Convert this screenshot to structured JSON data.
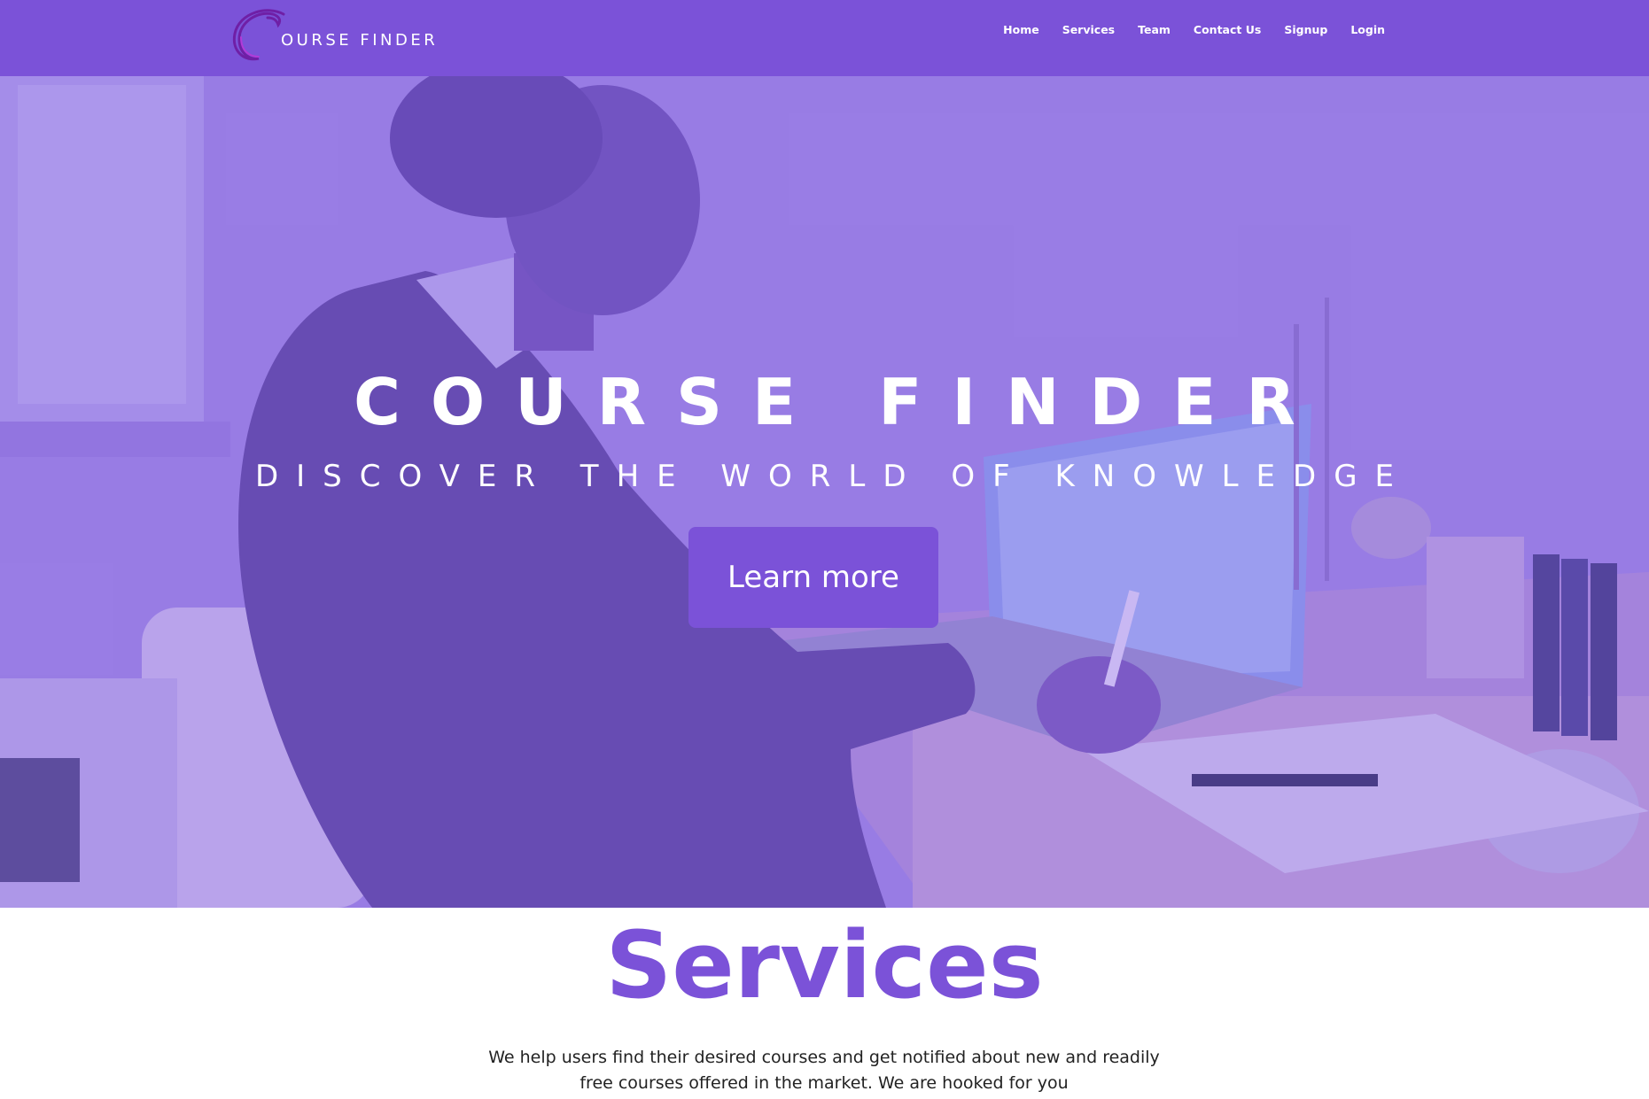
{
  "navbar": {
    "brand": {
      "text": "OURSE FINDER",
      "icon": "c-swirl-logo-icon"
    },
    "links": [
      {
        "label": "Home"
      },
      {
        "label": "Services"
      },
      {
        "label": "Team"
      },
      {
        "label": "Contact Us"
      },
      {
        "label": "Signup"
      },
      {
        "label": "Login"
      }
    ]
  },
  "hero": {
    "title": "COURSE FINDER",
    "subtitle": "DISCOVER THE WORLD OF KNOWLEDGE",
    "button_label": "Learn more"
  },
  "services": {
    "title": "Services",
    "description": "We help users find their desired courses and get notified about new and readily free courses offered in the market. We are hooked for you"
  },
  "colors": {
    "primary": "#7b52d8",
    "hero_tint": "#a289e6",
    "text_dark": "#222222",
    "white": "#ffffff"
  }
}
